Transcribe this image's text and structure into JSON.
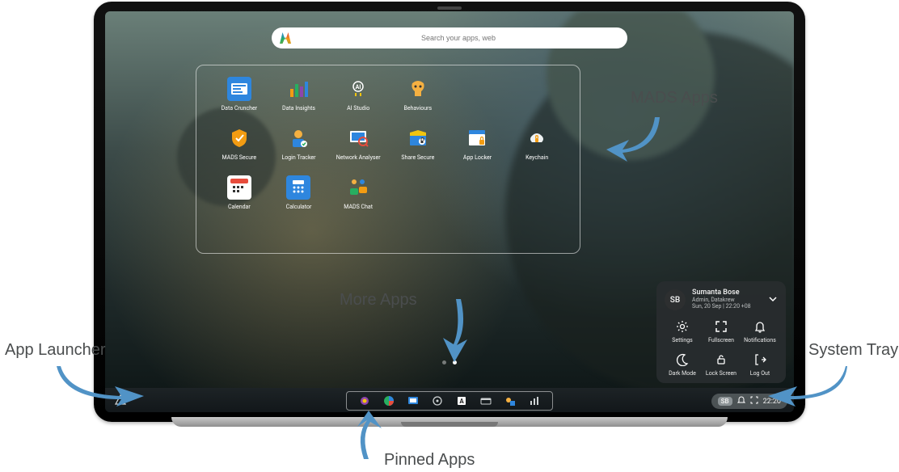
{
  "search": {
    "placeholder": "Search your apps, web"
  },
  "apps": [
    {
      "label": "Data Cruncher",
      "icon": "data-cruncher-icon"
    },
    {
      "label": "Data Insights",
      "icon": "data-insights-icon"
    },
    {
      "label": "AI Studio",
      "icon": "ai-studio-icon"
    },
    {
      "label": "Behaviours",
      "icon": "behaviours-icon"
    },
    {
      "label": "MADS Secure",
      "icon": "mads-secure-icon"
    },
    {
      "label": "Login Tracker",
      "icon": "login-tracker-icon"
    },
    {
      "label": "Network Analyser",
      "icon": "network-analyser-icon"
    },
    {
      "label": "Share Secure",
      "icon": "share-secure-icon"
    },
    {
      "label": "App Locker",
      "icon": "app-locker-icon"
    },
    {
      "label": "Keychain",
      "icon": "keychain-icon"
    },
    {
      "label": "Calendar",
      "icon": "calendar-icon"
    },
    {
      "label": "Calculator",
      "icon": "calculator-icon"
    },
    {
      "label": "MADS Chat",
      "icon": "mads-chat-icon"
    }
  ],
  "pages": {
    "count": 2,
    "active": 1
  },
  "pinned": [
    {
      "name": "pinned-app-1"
    },
    {
      "name": "pinned-app-2"
    },
    {
      "name": "pinned-app-3"
    },
    {
      "name": "pinned-app-4"
    },
    {
      "name": "pinned-app-5"
    },
    {
      "name": "pinned-app-6"
    },
    {
      "name": "pinned-app-7"
    },
    {
      "name": "pinned-app-8"
    }
  ],
  "tray": {
    "badge": "SB",
    "time": "22:20",
    "user": {
      "initials": "SB",
      "name": "Sumanta Bose",
      "role": "Admin, Datakrew",
      "datetime": "Sun, 20 Sep | 22:20 +08"
    },
    "actions": [
      {
        "label": "Settings",
        "icon": "gear-icon"
      },
      {
        "label": "Fullscreen",
        "icon": "fullscreen-icon"
      },
      {
        "label": "Notifications",
        "icon": "bell-icon"
      },
      {
        "label": "Dark Mode",
        "icon": "moon-icon"
      },
      {
        "label": "Lock Screen",
        "icon": "lock-icon"
      },
      {
        "label": "Log Out",
        "icon": "logout-icon"
      }
    ]
  },
  "callouts": {
    "mads_apps": "MADS Apps",
    "more_apps": "More Apps",
    "app_launcher": "App Launcher",
    "pinned_apps": "Pinned Apps",
    "system_tray": "System Tray"
  }
}
